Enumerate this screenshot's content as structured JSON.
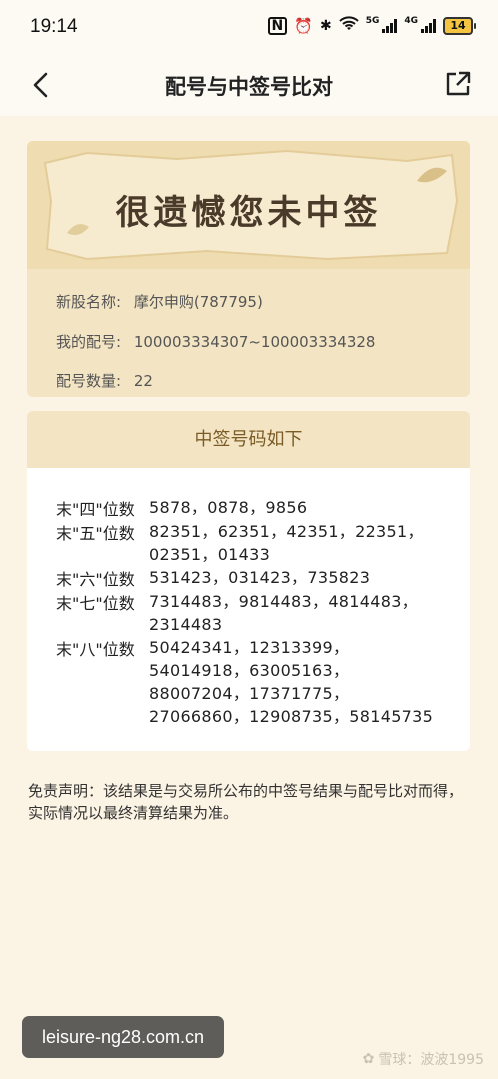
{
  "status_bar": {
    "time": "19:14",
    "signal1_label": "5G",
    "signal2_label": "4G",
    "battery": "14"
  },
  "nav": {
    "title": "配号与中签号比对"
  },
  "result": {
    "headline": "很遗憾您未中签",
    "stock_name_label": "新股名称:",
    "stock_name_value": "摩尔申购(787795)",
    "my_numbers_label": "我的配号:",
    "my_numbers_value": "100003334307~100003334328",
    "count_label": "配号数量:",
    "count_value": "22"
  },
  "winning": {
    "header": "中签号码如下",
    "rows": [
      {
        "label": "末\"四\"位数",
        "lines": [
          "5878，0878，9856"
        ]
      },
      {
        "label": "末\"五\"位数",
        "lines": [
          "82351，62351，42351，22351，",
          "02351，01433"
        ]
      },
      {
        "label": "末\"六\"位数",
        "lines": [
          "531423，031423，735823"
        ]
      },
      {
        "label": "末\"七\"位数",
        "lines": [
          "7314483，9814483，4814483，",
          "2314483"
        ]
      },
      {
        "label": "末\"八\"位数",
        "lines": [
          "50424341，12313399，",
          "54014918，63005163，",
          "88007204，17371775，",
          "27066860，12908735，58145735"
        ]
      }
    ]
  },
  "disclaimer": "免责声明：该结果是与交易所公布的中签号结果与配号比对而得，实际情况以最终清算结果为准。",
  "watermarks": {
    "site": "leisure-ng28.com.cn",
    "brand": "雪球：波波1995"
  },
  "colors": {
    "page_bg": "#fbf3e3",
    "card_bg": "#f3e5c4",
    "header_text": "#7a5a25",
    "headline_text": "#4a3a2a"
  }
}
